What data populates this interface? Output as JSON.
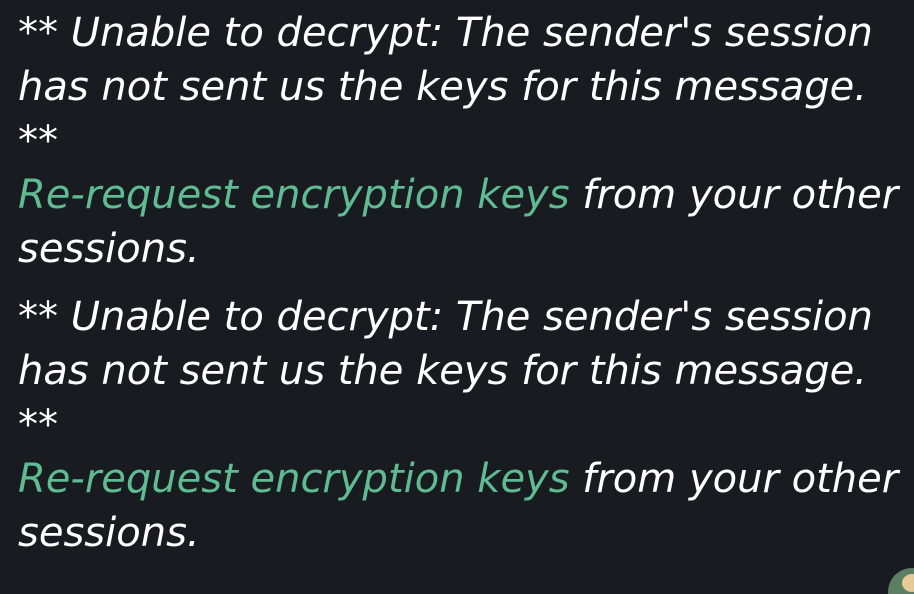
{
  "timeline": {
    "events": [
      {
        "notice": "** Unable to decrypt: The sender's session has not sent us the keys for this message. **",
        "link_label": "Re-request encryption keys",
        "link_suffix": "from your other sessions."
      },
      {
        "notice": "** Unable to decrypt: The sender's session has not sent us the keys for this message. **",
        "link_label": "Re-request encryption keys",
        "link_suffix": "from your other sessions."
      }
    ]
  }
}
